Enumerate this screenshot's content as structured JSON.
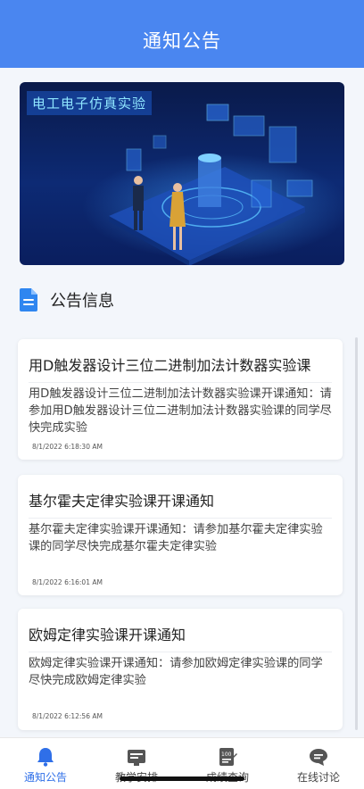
{
  "header": {
    "title": "通知公告"
  },
  "banner": {
    "title": "电工电子仿真实验"
  },
  "section": {
    "title": "公告信息"
  },
  "notices": [
    {
      "title": "用D触发器设计三位二进制加法计数器实验课",
      "body": "用D触发器设计三位二进制加法计数器实验课开课通知：请参加用D触发器设计三位二进制加法计数器实验课的同学尽快完成实验",
      "time": "8/1/2022 6:18:30 AM"
    },
    {
      "title": "基尔霍夫定律实验课开课通知",
      "body": "基尔霍夫定律实验课开课通知：请参加基尔霍夫定律实验课的同学尽快完成基尔霍夫定律实验",
      "time": "8/1/2022 6:16:01 AM"
    },
    {
      "title": "欧姆定律实验课开课通知",
      "body": "欧姆定律实验课开课通知：请参加欧姆定律实验课的同学尽快完成欧姆定律实验",
      "time": "8/1/2022 6:12:56 AM"
    }
  ],
  "tabs": [
    {
      "label": "通知公告",
      "icon": "bell-icon",
      "active": true
    },
    {
      "label": "教学安排",
      "icon": "schedule-icon",
      "active": false
    },
    {
      "label": "成绩查询",
      "icon": "score-icon",
      "active": false
    },
    {
      "label": "在线讨论",
      "icon": "chat-icon",
      "active": false
    }
  ],
  "colors": {
    "primary": "#4a86f0",
    "active_tab": "#2f6fe8"
  }
}
